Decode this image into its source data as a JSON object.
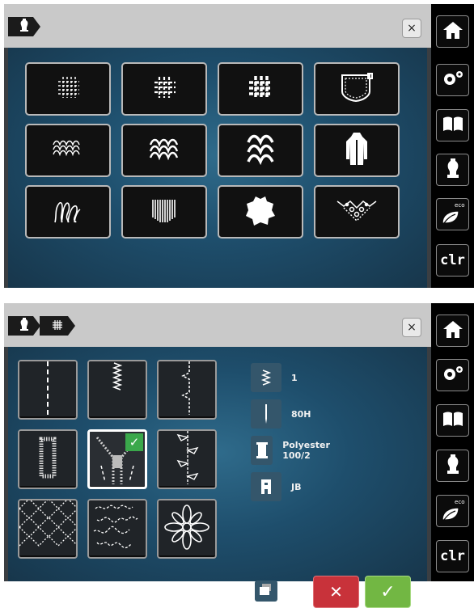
{
  "panel_top": {
    "breadcrumb": [
      "dress-form-icon"
    ],
    "close_label": "×",
    "material_tiles": [
      {
        "icon": "light-woven-fabric-icon"
      },
      {
        "icon": "medium-woven-fabric-icon"
      },
      {
        "icon": "heavy-woven-fabric-icon"
      },
      {
        "icon": "jeans-pocket-icon"
      },
      {
        "icon": "light-knit-icon"
      },
      {
        "icon": "medium-knit-icon"
      },
      {
        "icon": "heavy-knit-icon"
      },
      {
        "icon": "coat-icon"
      },
      {
        "icon": "pile-fabric-icon"
      },
      {
        "icon": "terry-cloth-icon"
      },
      {
        "icon": "leather-icon"
      },
      {
        "icon": "lace-icon"
      }
    ]
  },
  "panel_bottom": {
    "breadcrumb": [
      "dress-form-icon",
      "light-woven-fabric-icon"
    ],
    "close_label": "×",
    "stitch_tiles": [
      {
        "icon": "straight-stitch-icon",
        "selected": false
      },
      {
        "icon": "zigzag-stitch-icon",
        "selected": false
      },
      {
        "icon": "blind-hem-icon",
        "selected": false
      },
      {
        "icon": "buttonhole-icon",
        "selected": false
      },
      {
        "icon": "zipper-icon",
        "selected": true
      },
      {
        "icon": "decorative-edge-icon",
        "selected": false
      },
      {
        "icon": "quilting-pattern-icon",
        "selected": false
      },
      {
        "icon": "stipple-pattern-icon",
        "selected": false
      },
      {
        "icon": "flower-motif-icon",
        "selected": false
      }
    ],
    "recommendations": [
      {
        "icon": "stitch-width-icon",
        "text": "1"
      },
      {
        "icon": "needle-icon",
        "text": "80H"
      },
      {
        "icon": "thread-spool-icon",
        "text": "Polyester 100/2"
      },
      {
        "icon": "presser-foot-icon",
        "text": "JB"
      }
    ],
    "cancel_label": "✕",
    "confirm_label": "✓"
  },
  "sidebar": {
    "buttons": [
      "home-icon",
      "setup-icon",
      "tutorial-icon",
      "sewing-consultant-icon",
      "eco-icon",
      "clr"
    ],
    "clr_label": "clr",
    "eco_label": "eco"
  },
  "colors": {
    "panel_blue": "#1e4e6c",
    "confirm_green": "#72b743",
    "cancel_red": "#c8323a",
    "selected_check": "#3aa84b"
  }
}
